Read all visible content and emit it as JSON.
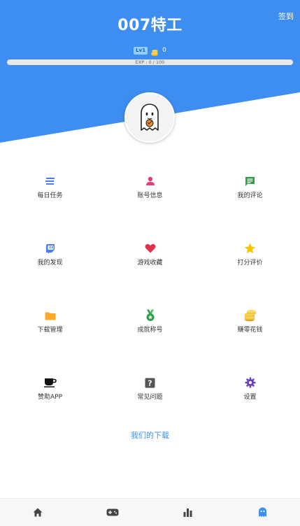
{
  "colors": {
    "header_blue": "#3d8ef0",
    "accent_pink": "#e0407b",
    "link_blue": "#3d8ef0"
  },
  "header": {
    "title": "007特工",
    "signin_label": "签到",
    "level_badge": "Lv1",
    "coins": "0",
    "exp_text": "EXP : 0 / 100",
    "exp_progress": 0
  },
  "menu": [
    {
      "label": "每日任务",
      "icon": "list-icon"
    },
    {
      "label": "账号信息",
      "icon": "person-icon"
    },
    {
      "label": "我的评论",
      "icon": "comment-icon"
    },
    {
      "label": "我的发现",
      "icon": "twitch-icon"
    },
    {
      "label": "游戏收藏",
      "icon": "heart-icon"
    },
    {
      "label": "打分评价",
      "icon": "star-icon"
    },
    {
      "label": "下载管理",
      "icon": "folder-icon"
    },
    {
      "label": "成就称号",
      "icon": "medal-icon"
    },
    {
      "label": "赚零花钱",
      "icon": "coins-icon"
    },
    {
      "label": "赞助APP",
      "icon": "coffee-icon"
    },
    {
      "label": "常见问题",
      "icon": "help-icon"
    },
    {
      "label": "设置",
      "icon": "gear-icon"
    }
  ],
  "downloads_link": "我们的下载",
  "bottom_nav": [
    {
      "icon": "home-icon"
    },
    {
      "icon": "gamepad-icon"
    },
    {
      "icon": "chart-icon"
    },
    {
      "icon": "ghost-icon",
      "active": true
    }
  ]
}
